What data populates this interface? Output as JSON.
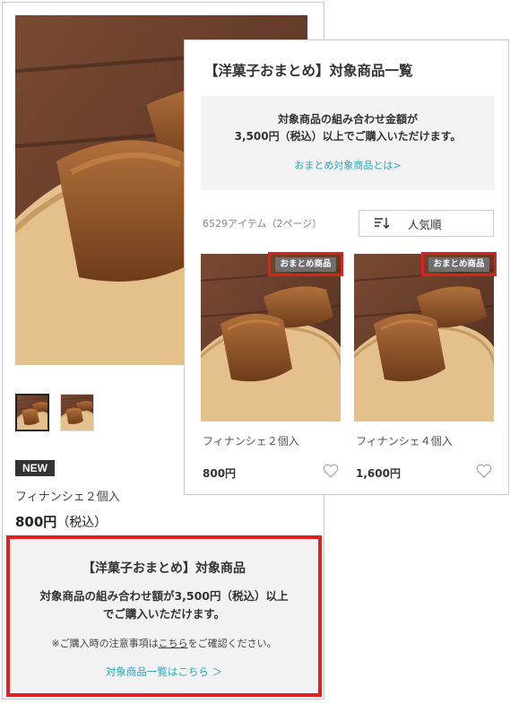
{
  "detail": {
    "badge": "NEW",
    "name": "フィナンシェ２個入",
    "price": "800円",
    "price_tax": "（税込）",
    "thumbnails": [
      "thumb-1",
      "thumb-2"
    ]
  },
  "promo": {
    "title": "【洋菓子おまとめ】対象商品",
    "desc_line1": "対象商品の組み合わせ額が3,500円（税込）以上",
    "desc_line2": "でご購入いただけます。",
    "note_prefix": "※ご購入時の注意事項は",
    "note_link": "こちら",
    "note_suffix": "をご確認ください。",
    "link": "対象商品一覧はこちら ＞",
    "border_color": "#e02020"
  },
  "list": {
    "title": "【洋菓子おまとめ】対象商品一覧",
    "info_line1": "対象商品の組み合わせ金額が",
    "info_line2": "3,500円（税込）以上でご購入いただけます。",
    "info_link": "おまとめ対象商品とは>",
    "item_count": "6529アイテム（2ページ）",
    "sort_label": "人気順",
    "products": [
      {
        "tag": "おまとめ商品",
        "name": "フィナンシェ２個入",
        "price": "800円"
      },
      {
        "tag": "おまとめ商品",
        "name": "フィナンシェ４個入",
        "price": "1,600円"
      }
    ],
    "accent_color": "#2aa7c0"
  }
}
